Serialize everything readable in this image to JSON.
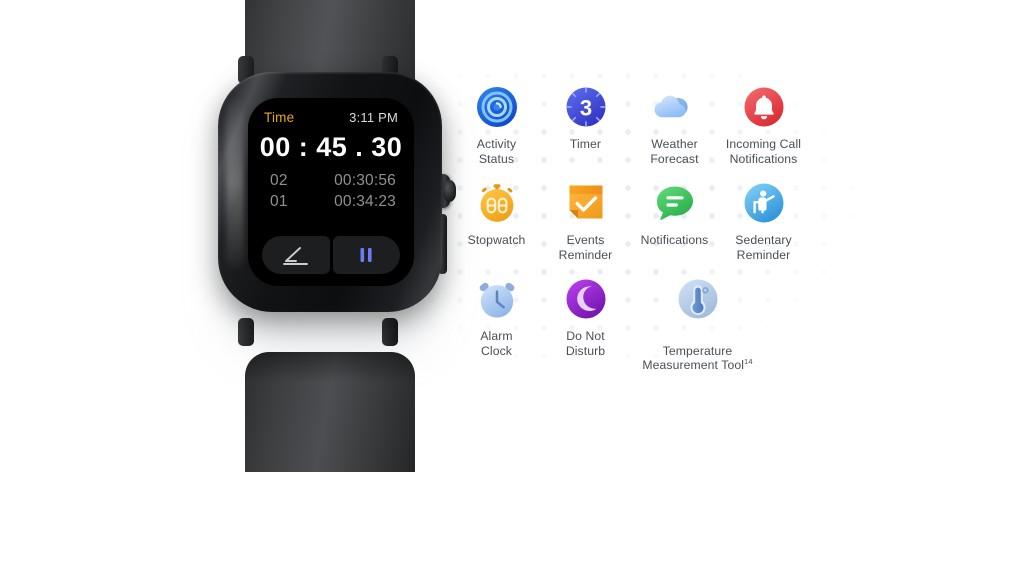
{
  "watch": {
    "screen": {
      "status_label": "Time",
      "status_time": "3:11 PM",
      "elapsed_time": "00 : 45 . 30",
      "laps": [
        {
          "index": "02",
          "value": "00:30:56"
        },
        {
          "index": "01",
          "value": "00:34:23"
        }
      ],
      "controls": {
        "edit_icon": "pencil-icon",
        "pause_icon": "pause-icon"
      }
    },
    "hardware": {
      "crown_icon": "crown-button",
      "band_material": "black silicone"
    }
  },
  "features": {
    "rows": [
      [
        {
          "label": "Activity\nStatus",
          "icon": "activity-status-icon",
          "color": "#1769d6"
        },
        {
          "label": "Timer",
          "icon": "timer-icon",
          "color": "#3d54d6",
          "badge": "3"
        },
        {
          "label": "Weather\nForecast",
          "icon": "weather-forecast-icon",
          "color": "#a9ceff"
        },
        {
          "label": "Incoming Call\nNotifications",
          "icon": "incoming-call-icon",
          "color": "#e8444a"
        }
      ],
      [
        {
          "label": "Stopwatch",
          "icon": "stopwatch-icon",
          "color": "#f2a81c",
          "badge": "08"
        },
        {
          "label": "Events\nReminder",
          "icon": "events-reminder-icon",
          "color": "#f0a427"
        },
        {
          "label": "Notifications",
          "icon": "notifications-icon",
          "color": "#3fc15e"
        },
        {
          "label": "Sedentary\nReminder",
          "icon": "sedentary-reminder-icon",
          "color": "#4fb3ef"
        }
      ],
      [
        {
          "label": "Alarm\nClock",
          "icon": "alarm-clock-icon",
          "color": "#9fc4f2"
        },
        {
          "label": "Do Not\nDisturb",
          "icon": "do-not-disturb-icon",
          "color": "#9a2ad6"
        },
        {
          "label": "Temperature\nMeasurement Tool",
          "icon": "temperature-tool-icon",
          "color": "#9bb6e0",
          "superscript": "14"
        }
      ]
    ]
  },
  "background": {
    "page_color": "#ffffff",
    "dot_color": "#e9edf2"
  }
}
